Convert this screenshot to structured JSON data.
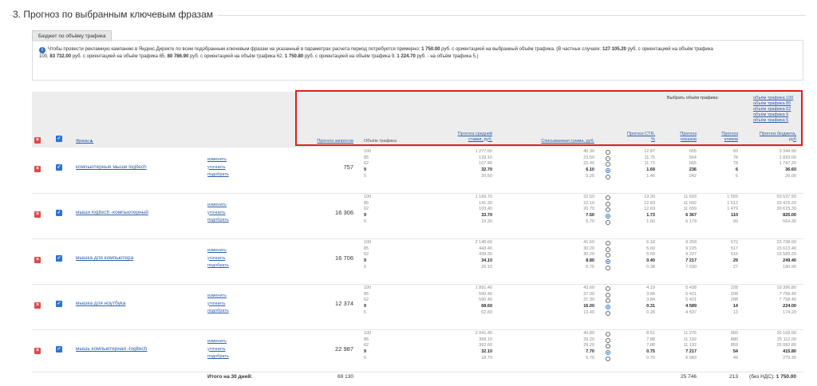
{
  "section": {
    "title": "3. Прогноз по выбранным ключевым фразам"
  },
  "tab": {
    "label": "Бюджет по объёму трафика"
  },
  "info": {
    "intro": "Чтобы провести рекламную кампанию в Яндекс.Директе по всем подобранным ключевым фразам на указанный в параметрах расчета период потребуется примерно:",
    "amount": "1 750.00",
    "mid": "руб. с ориентацией на выбранный объём трафика. (В частных случаях:",
    "a1": "127 105.20",
    "t1": "руб. с ориентацией на объём трафика",
    "t1b": "100,",
    "a2": "83 732.00",
    "t2": "руб. с ориентацией на объём трафика 85,",
    "a3": "80 786.90",
    "t3": "руб. с ориентацией на объём трафика 62,",
    "a4": "1 750.80",
    "t4": "руб. с ориентацией на объём трафика 9,",
    "a5": "1 224.70",
    "t5": "руб. - на объём трафика 5.)"
  },
  "header": {
    "phrases": "Фразы▲",
    "requests": "Прогноз запросов",
    "traffic": "Объём трафика",
    "avg_bid": "Прогноз средней ставки, руб.",
    "charged": "Списываемая сумма, руб.",
    "ctr": "Прогноз CTR, %",
    "impressions": "Прогноз показов",
    "clicks": "Прогноз кликов",
    "budget": "Прогноз бюджета, руб",
    "select_label": "Выбрать объём трафика:",
    "volume_links": [
      "объём трафика 100",
      "объём трафика 85",
      "объём трафика 62",
      "объём трафика 9",
      "объём трафика 5"
    ]
  },
  "actions": {
    "edit": "изменить",
    "refine": "уточнить",
    "pick": "подобрать"
  },
  "levels": [
    "100",
    "85",
    "62",
    "9",
    "5"
  ],
  "selected_index": 3,
  "rows": [
    {
      "phrase": "компьютерные мыши logitech",
      "requests": "757",
      "bid": [
        "1 277.60",
        "133.10",
        "107.40",
        "32.70",
        "20.50"
      ],
      "charged": [
        "40.30",
        "23.50",
        "22.40",
        "6.10",
        "5.20"
      ],
      "ctr": [
        "12.87",
        "11.75",
        "11.73",
        "1.69",
        "1.46"
      ],
      "shows": [
        "655",
        "664",
        "665",
        "236",
        "242"
      ],
      "clicks": [
        "83",
        "78",
        "78",
        "6",
        "5"
      ],
      "budget": [
        "3 344.90",
        "1 833.00",
        "1 747.20",
        "36.60",
        "26.00"
      ]
    },
    {
      "phrase": "мыши logitech -компьютерный",
      "requests": "16 306",
      "bid": [
        "1 169.70",
        "141.30",
        "103.40",
        "33.70",
        "19.30"
      ],
      "charged": [
        "32.50",
        "22.10",
        "20.70",
        "7.50",
        "5.70"
      ],
      "ctr": [
        "13.30",
        "12.83",
        "12.69",
        "1.73",
        "1.60"
      ],
      "shows": [
        "11 693",
        "11 692",
        "11 659",
        "6 367",
        "6 179"
      ],
      "clicks": [
        "1 555",
        "1 512",
        "1 479",
        "110",
        "99"
      ],
      "budget": [
        "50 537.50",
        "33 415.20",
        "30 615.30",
        "825.00",
        "564.30"
      ]
    },
    {
      "phrase": "мышка для компьютера",
      "requests": "16 706",
      "bid": [
        "2 148.60",
        "443.40",
        "439.30",
        "34.10",
        "25.10"
      ],
      "charged": [
        "41.50",
        "30.20",
        "30.20",
        "8.80",
        "6.70"
      ],
      "ctr": [
        "6.18",
        "5.60",
        "5.59",
        "0.40",
        "0.38"
      ],
      "shows": [
        "9 258",
        "9 225",
        "9 227",
        "7 217",
        "7 030"
      ],
      "clicks": [
        "572",
        "517",
        "516",
        "29",
        "27"
      ],
      "budget": [
        "23 738.00",
        "15 613.40",
        "15 583.20",
        "249.40",
        "180.90"
      ]
    },
    {
      "phrase": "мышка для ноутбука",
      "requests": "12 374",
      "bid": [
        "1 891.40",
        "590.40",
        "590.40",
        "68.60",
        "52.80"
      ],
      "charged": [
        "43.60",
        "37.30",
        "37.30",
        "16.00",
        "13.40"
      ],
      "ctr": [
        "4.19",
        "3.84",
        "3.84",
        "0.31",
        "0.28"
      ],
      "shows": [
        "5 438",
        "5 421",
        "5 421",
        "4 589",
        "4 507"
      ],
      "clicks": [
        "228",
        "208",
        "208",
        "14",
        "13"
      ],
      "budget": [
        "10 396.80",
        "7 758.40",
        "7 758.40",
        "224.00",
        "174.20"
      ]
    },
    {
      "phrase": "мышь компьютерная -logitech",
      "requests": "22 987",
      "bid": [
        "2 041.40",
        "368.10",
        "362.60",
        "32.10",
        "18.70"
      ],
      "charged": [
        "40.80",
        "29.20",
        "29.20",
        "7.70",
        "5.70"
      ],
      "ctr": [
        "8.51",
        "7.88",
        "7.88",
        "0.75",
        "0.70"
      ],
      "shows": [
        "11 276",
        "11 192",
        "11 192",
        "7 217",
        "6 983"
      ],
      "clicks": [
        "960",
        "880",
        "859",
        "54",
        "49"
      ],
      "budget": [
        "39 168.00",
        "25 112.00",
        "25 082.80",
        "415.80",
        "279.30"
      ]
    }
  ],
  "totals": {
    "label": "Итого на 30 дней:",
    "requests": "69 130",
    "shows": "25 746",
    "clicks": "213",
    "budget_prefix": "(без НДС):",
    "budget": "1 750.00"
  }
}
